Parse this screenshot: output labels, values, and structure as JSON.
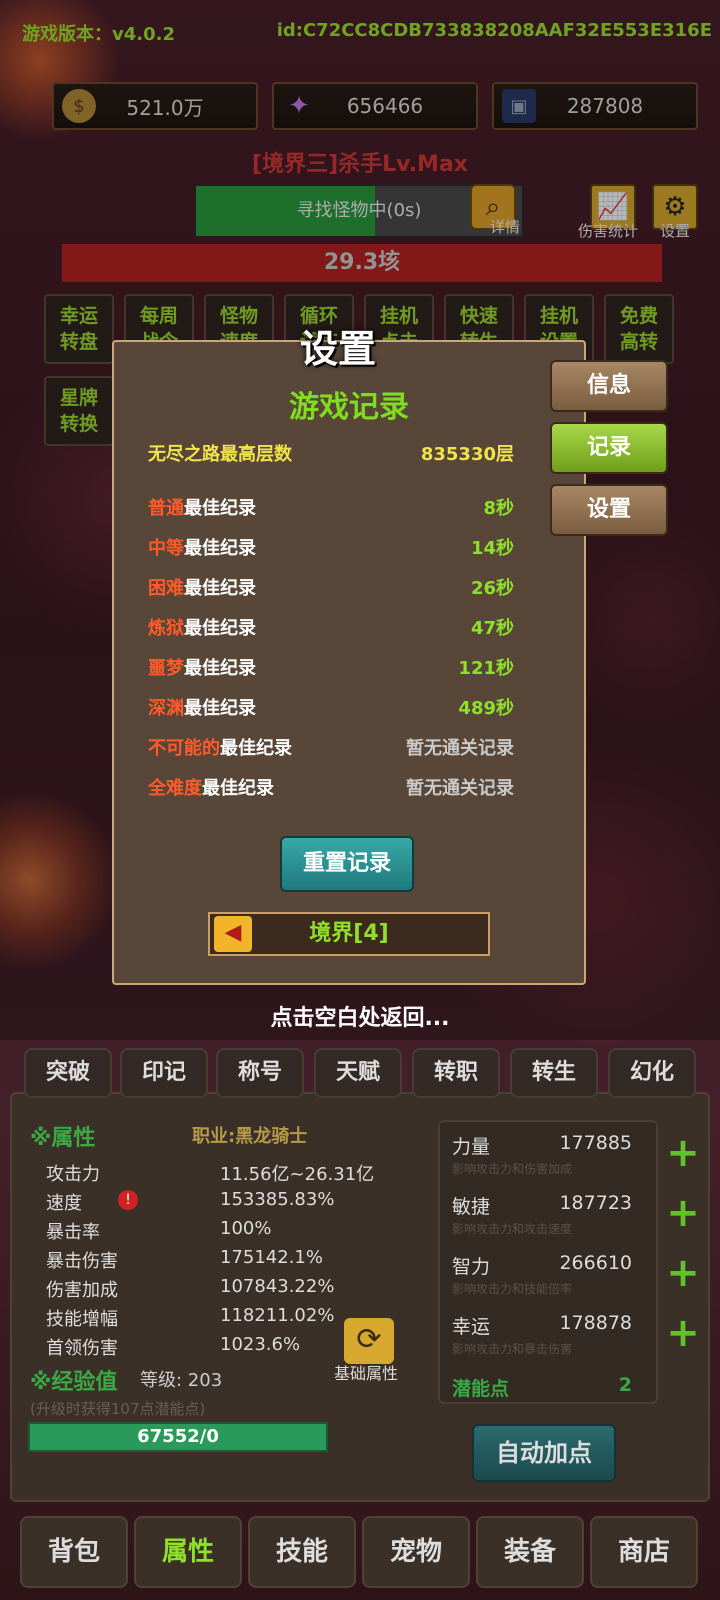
{
  "header": {
    "version": "游戏版本：v4.0.2",
    "id": "id:C72CC8CDB733838208AAF32E553E316E"
  },
  "resources": [
    {
      "icon": "coin-icon",
      "value": "521.0万"
    },
    {
      "icon": "crystal-icon",
      "value": "656466"
    },
    {
      "icon": "card-icon",
      "value": "287808"
    }
  ],
  "realm_title": "[境界三]杀手Lv.Max",
  "search": {
    "label": "寻找怪物中(0s)",
    "detail": "详情",
    "progress": 0.55
  },
  "top_buttons": {
    "damage": "伤害统计",
    "settings": "设置"
  },
  "hp": "29.3垓",
  "grid": [
    "幸运\n转盘",
    "每周\n战令",
    "怪物\n速度",
    "循环\n试炼",
    "挂机\n点击",
    "快速\n转生",
    "挂机\n设置",
    "免费\n高转",
    "星牌\n转换"
  ],
  "dialog": {
    "title": "设置",
    "section": "游戏记录",
    "endless": {
      "label": "无尽之路最高层数",
      "value": "835330层"
    },
    "records": [
      {
        "d": "普通",
        "s": "最佳纪录",
        "v": "8秒"
      },
      {
        "d": "中等",
        "s": "最佳纪录",
        "v": "14秒"
      },
      {
        "d": "困难",
        "s": "最佳纪录",
        "v": "26秒"
      },
      {
        "d": "炼狱",
        "s": "最佳纪录",
        "v": "47秒"
      },
      {
        "d": "噩梦",
        "s": "最佳纪录",
        "v": "121秒"
      },
      {
        "d": "深渊",
        "s": "最佳纪录",
        "v": "489秒"
      },
      {
        "d": "不可能的",
        "s": "最佳纪录",
        "v": "暂无通关记录"
      },
      {
        "d": "全难度",
        "s": "最佳纪录",
        "v": "暂无通关记录"
      }
    ],
    "reset": "重置记录",
    "realm": "境界[4]",
    "tabs": [
      "信息",
      "记录",
      "设置"
    ]
  },
  "hint": "点击空白处返回...",
  "sub_tabs": [
    "突破",
    "印记",
    "称号",
    "天赋",
    "转职",
    "转生",
    "幻化"
  ],
  "attrs": {
    "title": "※属性",
    "job": "职业:黑龙骑士",
    "rows": [
      {
        "k": "攻击力",
        "v": "11.56亿~26.31亿"
      },
      {
        "k": "速度",
        "v": "153385.83%"
      },
      {
        "k": "暴击率",
        "v": "100%"
      },
      {
        "k": "暴击伤害",
        "v": "175142.1%"
      },
      {
        "k": "伤害加成",
        "v": "107843.22%"
      },
      {
        "k": "技能增幅",
        "v": "118211.02%"
      },
      {
        "k": "首领伤害",
        "v": "1023.6%"
      }
    ],
    "base": "基础属性",
    "exp_title": "※经验值",
    "level": "等级: 203",
    "exp_hint": "(升级时获得107点潜能点)",
    "exp": "67552/0"
  },
  "stats": [
    {
      "k": "力量",
      "v": "177885",
      "d": "影响攻击力和伤害加成"
    },
    {
      "k": "敏捷",
      "v": "187723",
      "d": "影响攻击力和攻击速度"
    },
    {
      "k": "智力",
      "v": "266610",
      "d": "影响攻击力和技能倍率"
    },
    {
      "k": "幸运",
      "v": "178878",
      "d": "影响攻击力和暴击伤害"
    }
  ],
  "potential": {
    "k": "潜能点",
    "v": "2"
  },
  "auto": "自动加点",
  "nav": [
    "背包",
    "属性",
    "技能",
    "宠物",
    "装备",
    "商店"
  ]
}
